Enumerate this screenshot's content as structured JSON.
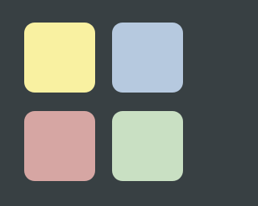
{
  "tiles": [
    {
      "id": "yellow",
      "color": "#f9f1a1"
    },
    {
      "id": "blue",
      "color": "#b6c9df"
    },
    {
      "id": "red",
      "color": "#d6a6a3"
    },
    {
      "id": "green",
      "color": "#c9e0c3"
    }
  ],
  "background_color": "#384043"
}
